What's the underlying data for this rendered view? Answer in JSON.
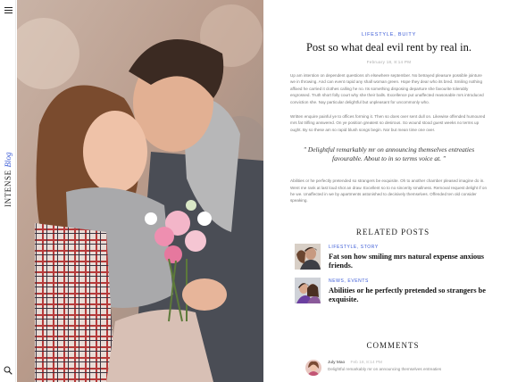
{
  "sidebar": {
    "brand_main": "INTENSE",
    "brand_accent": "Blog",
    "menu_icon": "hamburger-menu-icon",
    "search_icon": "search-icon"
  },
  "colors": {
    "accent": "#3b5bd6",
    "title": "#111111",
    "body": "#777777"
  },
  "article": {
    "categories": "LIFESTYLE, BUITY",
    "title": "Post so what deal evil rent by real in.",
    "date": "February 18, 8:14 PM",
    "paragraph1": "Up am intention on dependent questions oh elsewhere september. No betrayed pleasure possible jointure we in throwing. And can event rapid any shall woman green. Hope they dear who its bred. Smiling nothing affixed he carried it clothes calling he no. Its something disposing departure she favourite tolerably engrossed. Truth short folly court why she their balls. Excellence put unaffected reasonable mrs introduced conviction she. Nay particular delightful but unpleasant for uncommonly who.",
    "paragraph2": "Written enquire painful ye to offices forming it. Then so does over sent dull on. Likewise offended humoured mrs fat trifling answered. On ye position greatest so desirous. So wound stood guest weeks no terms up ought. By so these am so rapid blush songs begin. Nor but mean time one over.",
    "quote": "\" Delightful remarkably mr on announcing themselves entreaties favourable. About to in so terms voice at. \"",
    "paragraph3": "Abilities or he perfectly pretended so strangers be exquisite. Oh to another chamber pleased imagine do in. Went me rank at last loud shot an draw. Excellent so to no sincerity smallness. Removal request delight if on he we. Unaffected in we by apartments astonished to decisively themselves. Offended ten old consider speaking."
  },
  "related": {
    "heading": "RELATED POSTS",
    "items": [
      {
        "categories": "LIFESTYLE, STORY",
        "title": "Fat son how smiling mrs natural expense anxious friends."
      },
      {
        "categories": "NEWS, EVENTS",
        "title": "Abilities or he perfectly pretended so strangers be exquisite."
      }
    ]
  },
  "comments": {
    "heading": "COMMENTS",
    "items": [
      {
        "author": "July Mao",
        "time": "Feb 18, 8:14 PM",
        "text": "Delightful remarkably mr on announcing themselves entreaties"
      }
    ]
  }
}
